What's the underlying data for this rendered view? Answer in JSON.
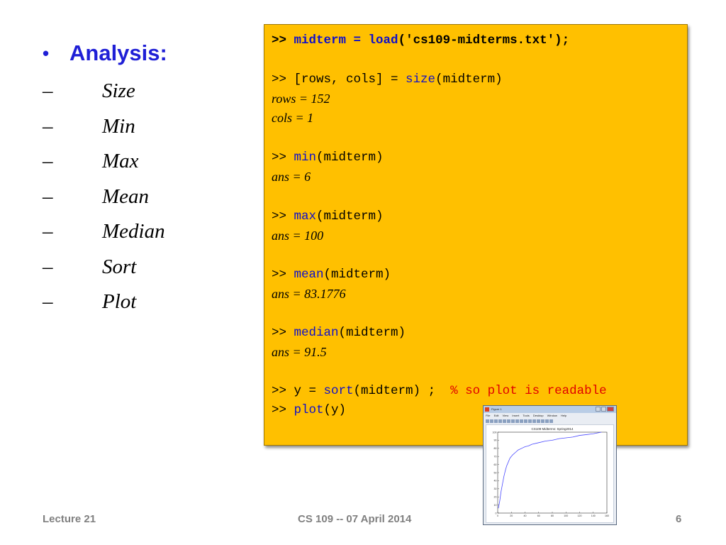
{
  "slide": {
    "bullet_symbol": "•",
    "heading": "Analysis:",
    "dash": "–",
    "items": [
      "Size",
      "Min",
      "Max",
      "Mean",
      "Median",
      "Sort",
      "Plot"
    ]
  },
  "code": {
    "prompt": ">>",
    "line1": {
      "pre": " midterm = ",
      "fn": "load",
      "post": "('cs109-midterms.txt');"
    },
    "line2": {
      "pre": " [rows, cols] = ",
      "fn": "size",
      "post": "(midterm)"
    },
    "res_rows": "rows = 152",
    "res_cols": "cols = 1",
    "line3": {
      "fn": "min",
      "post": "(midterm)"
    },
    "res_min": "ans = 6",
    "line4": {
      "fn": "max",
      "post": "(midterm)"
    },
    "res_max": "ans = 100",
    "line5": {
      "fn": "mean",
      "post": "(midterm)"
    },
    "res_mean": "ans = 83.1776",
    "line6": {
      "fn": "median",
      "post": "(midterm)"
    },
    "res_median": "ans = 91.5",
    "line7": {
      "pre": " y = ",
      "fn": "sort",
      "post": "(midterm) ;  ",
      "comment": "% so plot is readable"
    },
    "line8": {
      "fn": "plot",
      "post": "(y)"
    }
  },
  "figure": {
    "window_title": "Figure 1",
    "menu": [
      "File",
      "Edit",
      "View",
      "Insert",
      "Tools",
      "Desktop",
      "Window",
      "Help"
    ],
    "chart_data": {
      "type": "line",
      "title": "CS109 Midterms: Spring2014",
      "xlabel": "",
      "ylabel": "",
      "xlim": [
        0,
        160
      ],
      "ylim": [
        0,
        100
      ],
      "x_ticks": [
        0,
        20,
        40,
        60,
        80,
        100,
        120,
        140,
        160
      ],
      "y_ticks": [
        0,
        10,
        20,
        30,
        40,
        50,
        60,
        70,
        80,
        90,
        100
      ],
      "series": [
        {
          "color": "#4a4aff",
          "x": [
            1,
            3,
            5,
            7,
            9,
            11,
            13,
            15,
            18,
            22,
            26,
            30,
            35,
            40,
            45,
            50,
            60,
            70,
            80,
            90,
            100,
            110,
            120,
            130,
            140,
            152
          ],
          "y": [
            6,
            15,
            27,
            36,
            45,
            52,
            58,
            62,
            68,
            72,
            75,
            78,
            80,
            82,
            83,
            85,
            87,
            89,
            90,
            92,
            93,
            94,
            96,
            97,
            98,
            100
          ]
        }
      ]
    }
  },
  "footer": {
    "left": "Lecture 21",
    "center": "CS 109 -- 07 April 2014",
    "page": "6"
  }
}
